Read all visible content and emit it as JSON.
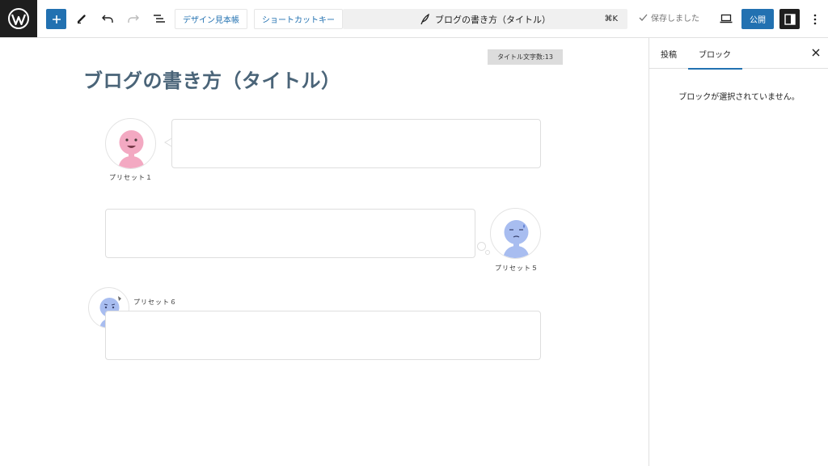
{
  "toolbar": {
    "design_sample_label": "デザイン見本帳",
    "shortcut_key_label": "ショートカットキー",
    "document_title": "ブログの書き方（タイトル）",
    "document_shortcut": "⌘K",
    "saved_label": "保存しました",
    "publish_label": "公開"
  },
  "editor": {
    "title_count": "タイトル文字数:13",
    "post_title": "ブログの書き方（タイトル）",
    "blocks": [
      {
        "caption": "プリセット１"
      },
      {
        "caption": "プリセット５"
      },
      {
        "caption": "プリセット６"
      }
    ]
  },
  "sidebar": {
    "tabs": [
      {
        "label": "投稿"
      },
      {
        "label": "ブロック"
      }
    ],
    "empty_message": "ブロックが選択されていません。"
  },
  "colors": {
    "accent": "#2271b1",
    "title_text": "#4a6478",
    "avatar_pink": "#f3a9c2",
    "avatar_blue": "#a8bdf0"
  }
}
